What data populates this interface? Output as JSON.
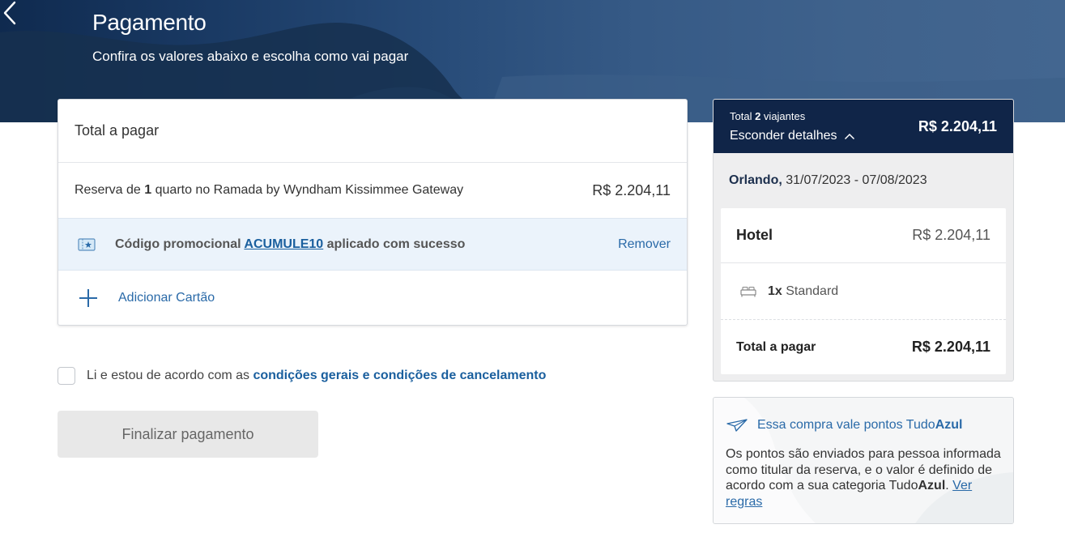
{
  "header": {
    "title": "Pagamento",
    "subtitle": "Confira os valores abaixo e escolha como vai pagar"
  },
  "payment": {
    "total_label": "Total a pagar",
    "reservation": {
      "prefix": "Reserva de ",
      "rooms": "1",
      "suffix": " quarto no Ramada by Wyndham Kissimmee Gateway",
      "price": "R$ 2.204,11"
    },
    "promo": {
      "prefix": "Código promocional ",
      "code": "ACUMULE10",
      "suffix": " aplicado com sucesso",
      "remove_label": "Remover"
    },
    "add_card_label": "Adicionar Cartão"
  },
  "terms": {
    "text": "Li e estou de acordo com as ",
    "link": "condições gerais e condições de cancelamento",
    "checked": false
  },
  "finalize_label": "Finalizar pagamento",
  "summary": {
    "travelers_prefix": "Total ",
    "travelers_count": "2",
    "travelers_suffix": " viajantes",
    "toggle_label": "Esconder detalhes",
    "total": "R$ 2.204,11",
    "destination": "Orlando,",
    "dates": " 31/07/2023 - 07/08/2023",
    "hotel_label": "Hotel",
    "hotel_price": "R$ 2.204,11",
    "room_qty": "1x",
    "room_type": " Standard",
    "total_label": "Total a pagar",
    "total_price": "R$ 2.204,11"
  },
  "points": {
    "title_prefix": "Essa compra vale pontos Tudo",
    "title_bold": "Azul",
    "body": "Os pontos são enviados para pessoa informada como titular da reserva, e o valor é definido de acordo com a sua categoria Tudo",
    "body_bold": "Azul",
    "body_end": ". ",
    "link": "Ver regras"
  },
  "colors": {
    "navy": "#102548",
    "link_blue": "#2a6aa8",
    "promo_bg": "#ebf3fb"
  }
}
